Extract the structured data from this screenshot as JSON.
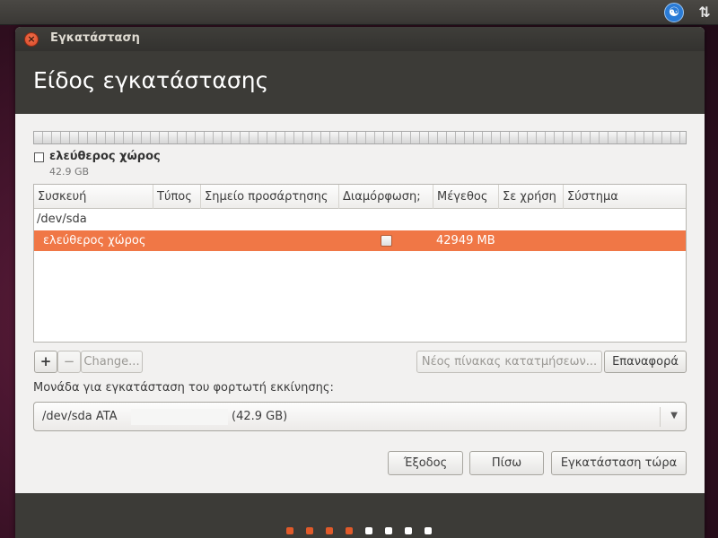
{
  "window": {
    "title": "Εγκατάσταση",
    "heading": "Είδος εγκατάστασης"
  },
  "legend": {
    "label": "ελεύθερος χώρος",
    "size": "42.9 GB"
  },
  "table": {
    "columns": [
      "Συσκευή",
      "Τύπος",
      "Σημείο προσάρτησης",
      "Διαμόρφωση;",
      "Μέγεθος",
      "Σε χρήση",
      "Σύστημα"
    ],
    "device": "/dev/sda",
    "selected_row": {
      "device": "ελεύθερος χώρος",
      "format": false,
      "size": "42949 MB"
    }
  },
  "buttons": {
    "add": "+",
    "remove": "−",
    "change": "Change...",
    "new_table": "Νέος πίνακας κατατμήσεων...",
    "revert": "Επαναφορά",
    "quit": "Έξοδος",
    "back": "Πίσω",
    "install_now": "Εγκατάσταση τώρα"
  },
  "bootloader": {
    "label": "Μονάδα για εγκατάσταση του φορτωτή εκκίνησης:",
    "value": "/dev/sda  ATA",
    "size": "(42.9 GB)"
  },
  "progress": {
    "total_steps": 8,
    "completed_steps": 4,
    "active_color": "#e05a2a",
    "inactive_color": "#ffffff"
  },
  "icons": {
    "accessibility": "accessibility-icon",
    "network": "network-icon",
    "close": "close-icon"
  }
}
